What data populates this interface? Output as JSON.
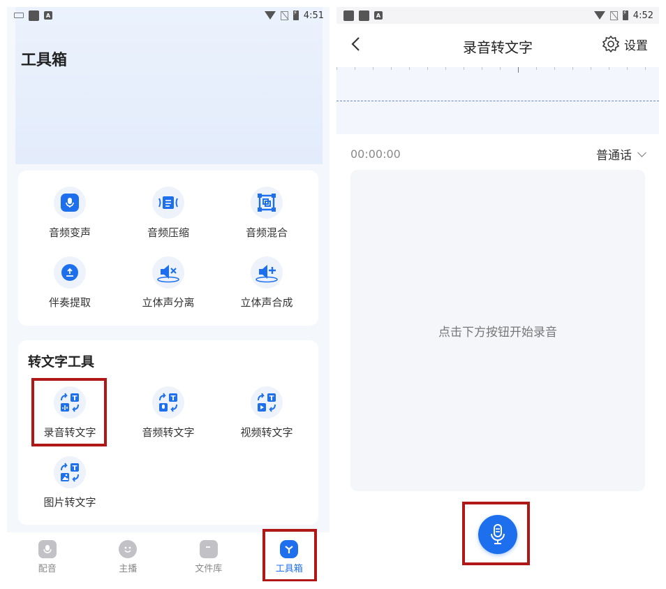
{
  "left": {
    "status": {
      "time": "4:51"
    },
    "title": "工具箱",
    "audio_tools": [
      {
        "label": "音频变声",
        "icon": "mic-square-icon"
      },
      {
        "label": "音频压缩",
        "icon": "compress-icon"
      },
      {
        "label": "音频混合",
        "icon": "mix-icon"
      },
      {
        "label": "伴奏提取",
        "icon": "extract-icon"
      },
      {
        "label": "立体声分离",
        "icon": "speaker-split-icon"
      },
      {
        "label": "立体声合成",
        "icon": "speaker-merge-icon"
      }
    ],
    "text_section": {
      "title": "转文字工具",
      "tools": [
        {
          "label": "录音转文字",
          "icon": "record-to-text-icon"
        },
        {
          "label": "音频转文字",
          "icon": "audio-to-text-icon"
        },
        {
          "label": "视频转文字",
          "icon": "video-to-text-icon"
        },
        {
          "label": "图片转文字",
          "icon": "image-to-text-icon"
        }
      ]
    },
    "tabbar": [
      {
        "label": "配音",
        "icon": "dubbing-icon",
        "active": false
      },
      {
        "label": "主播",
        "icon": "anchor-icon",
        "active": false
      },
      {
        "label": "文件库",
        "icon": "library-icon",
        "active": false
      },
      {
        "label": "工具箱",
        "icon": "toolbox-icon",
        "active": true
      }
    ],
    "colors": {
      "accent": "#1e6fee",
      "highlight": "#b01818"
    }
  },
  "right": {
    "status": {
      "time": "4:52"
    },
    "title": "录音转文字",
    "settings_label": "设置",
    "timer": "00:00:00",
    "language": "普通话",
    "hint": "点击下方按钮开始录音"
  }
}
